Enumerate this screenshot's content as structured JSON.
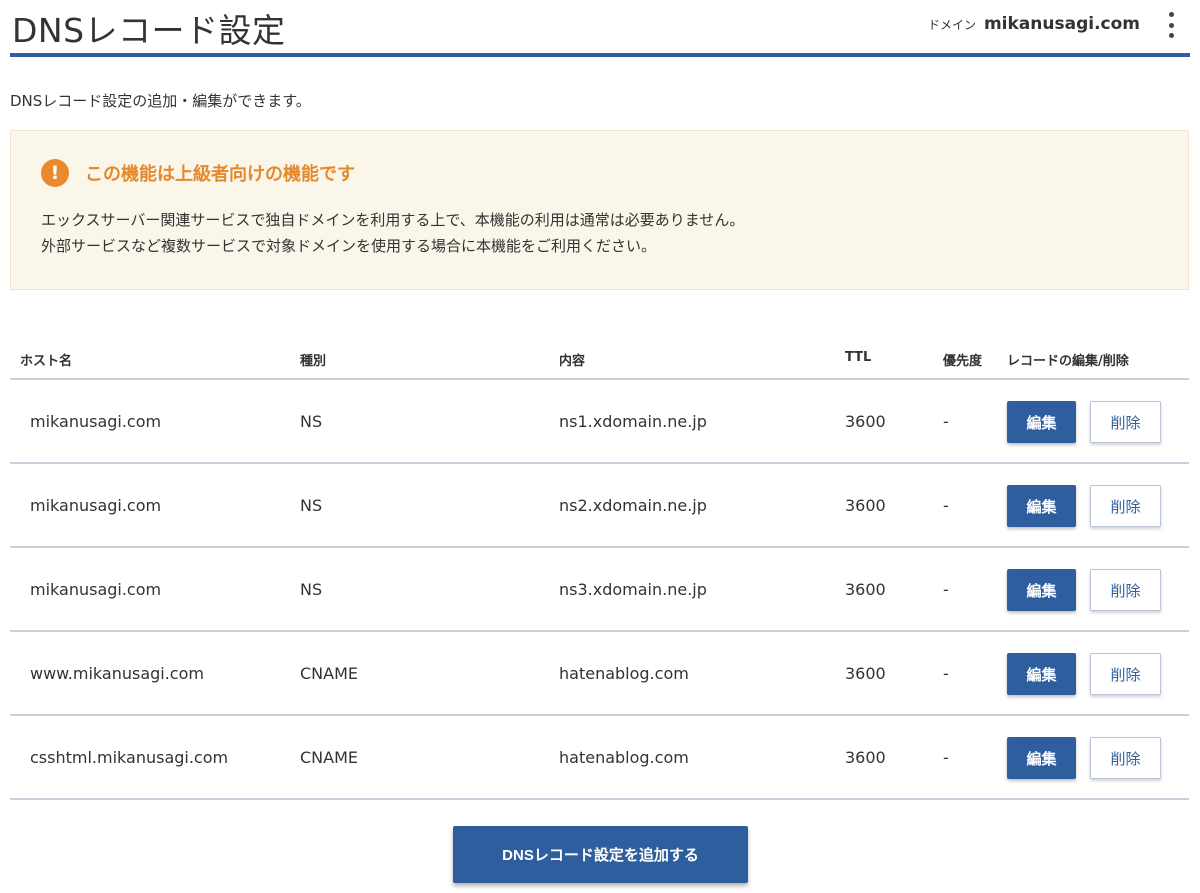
{
  "header": {
    "title": "DNSレコード設定",
    "domain_label": "ドメイン",
    "domain_value": "mikanusagi.com",
    "menu_icon": "kebab-menu-icon"
  },
  "intro": "DNSレコード設定の追加・編集ができます。",
  "notice": {
    "icon": "warning-icon",
    "icon_glyph": "!",
    "title": "この機能は上級者向けの機能です",
    "line1": "エックスサーバー関連サービスで独自ドメインを利用する上で、本機能の利用は通常は必要ありません。",
    "line2": "外部サービスなど複数サービスで対象ドメインを使用する場合に本機能をご利用ください。"
  },
  "table": {
    "headers": {
      "host": "ホスト名",
      "type": "種別",
      "content": "内容",
      "ttl": "TTL",
      "priority": "優先度",
      "actions": "レコードの編集/削除"
    },
    "rows": [
      {
        "host": "mikanusagi.com",
        "type": "NS",
        "content": "ns1.xdomain.ne.jp",
        "ttl": "3600",
        "priority": "-",
        "edit": "編集",
        "delete": "削除"
      },
      {
        "host": "mikanusagi.com",
        "type": "NS",
        "content": "ns2.xdomain.ne.jp",
        "ttl": "3600",
        "priority": "-",
        "edit": "編集",
        "delete": "削除"
      },
      {
        "host": "mikanusagi.com",
        "type": "NS",
        "content": "ns3.xdomain.ne.jp",
        "ttl": "3600",
        "priority": "-",
        "edit": "編集",
        "delete": "削除"
      },
      {
        "host": "www.mikanusagi.com",
        "type": "CNAME",
        "content": "hatenablog.com",
        "ttl": "3600",
        "priority": "-",
        "edit": "編集",
        "delete": "削除"
      },
      {
        "host": "csshtml.mikanusagi.com",
        "type": "CNAME",
        "content": "hatenablog.com",
        "ttl": "3600",
        "priority": "-",
        "edit": "編集",
        "delete": "削除"
      }
    ]
  },
  "add_button": "DNSレコード設定を追加する",
  "colors": {
    "primary": "#2f5e9e",
    "warning": "#e5892d",
    "notice_bg": "#fbf6ea"
  }
}
